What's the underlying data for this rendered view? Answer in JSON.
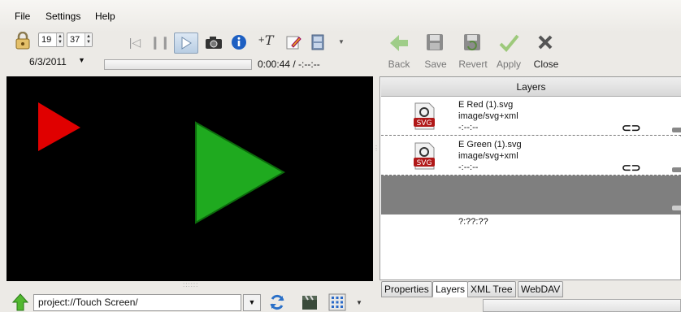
{
  "menu": {
    "items": [
      "File",
      "Settings",
      "Help"
    ]
  },
  "time_controls": {
    "hour": "19",
    "minute": "37",
    "date": "6/3/2011"
  },
  "playback": {
    "time_display": "0:00:44 / -:--:--",
    "progress": 0.0
  },
  "edit_toolbar": {
    "back": "Back",
    "save": "Save",
    "revert": "Revert",
    "apply": "Apply",
    "close": "Close"
  },
  "layers_panel": {
    "title": "Layers",
    "items": [
      {
        "name": "E Red (1).svg",
        "type": "image/svg+xml",
        "duration": "-:--:--",
        "icon_label": "SVG"
      },
      {
        "name": "E Green (1).svg",
        "type": "image/svg+xml",
        "duration": "-:--:--",
        "icon_label": "SVG"
      }
    ],
    "total_duration": "?:??:??"
  },
  "tabs": [
    {
      "label": "Properties",
      "active": false
    },
    {
      "label": "Layers",
      "active": true
    },
    {
      "label": "XML Tree",
      "active": false
    },
    {
      "label": "WebDAV",
      "active": false
    }
  ],
  "bottom_bar": {
    "path": "project://Touch Screen/"
  },
  "colors": {
    "preview_bg": "#000000",
    "red_triangle": "#e00000",
    "green_triangle": "#1faa1f",
    "selected_row": "#7f7f7f"
  }
}
